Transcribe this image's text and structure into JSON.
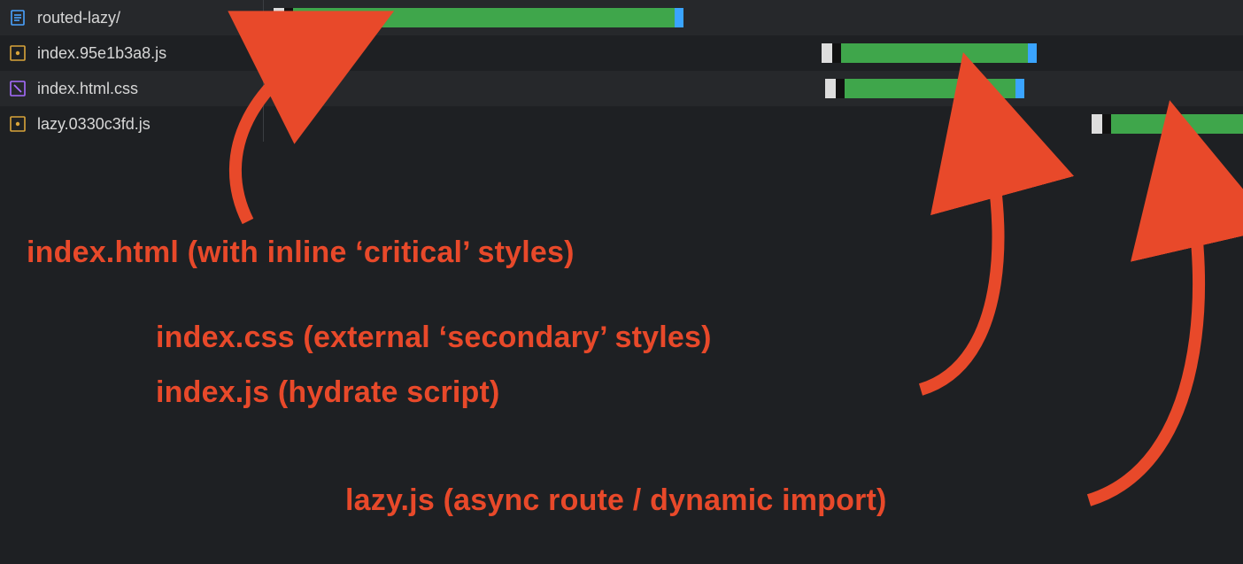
{
  "rows": [
    {
      "name": "routed-lazy/",
      "icon": "doc",
      "bar": {
        "left_pct": 1.0,
        "green_pct": 39.0
      }
    },
    {
      "name": "index.95e1b3a8.js",
      "icon": "js",
      "bar": {
        "left_pct": 57.0,
        "green_pct": 19.0
      }
    },
    {
      "name": "index.html.css",
      "icon": "css",
      "bar": {
        "left_pct": 57.3,
        "green_pct": 17.5
      }
    },
    {
      "name": "lazy.0330c3fd.js",
      "icon": "js",
      "bar": {
        "left_pct": 84.5,
        "green_pct": 15.0
      }
    }
  ],
  "gridlines_pct": [
    0.0,
    18.0,
    56.2,
    80.8
  ],
  "blue_line_pct": 80.8,
  "annotations": {
    "a1": "index.html (with inline ‘critical’ styles)",
    "a2": "index.css (external ‘secondary’ styles)",
    "a3": "index.js (hydrate script)",
    "a4": "lazy.js (async route / dynamic import)"
  },
  "colors": {
    "accent_red": "#e8492a",
    "bar_green": "#3fa64b",
    "bar_blue": "#3aa4ff"
  }
}
